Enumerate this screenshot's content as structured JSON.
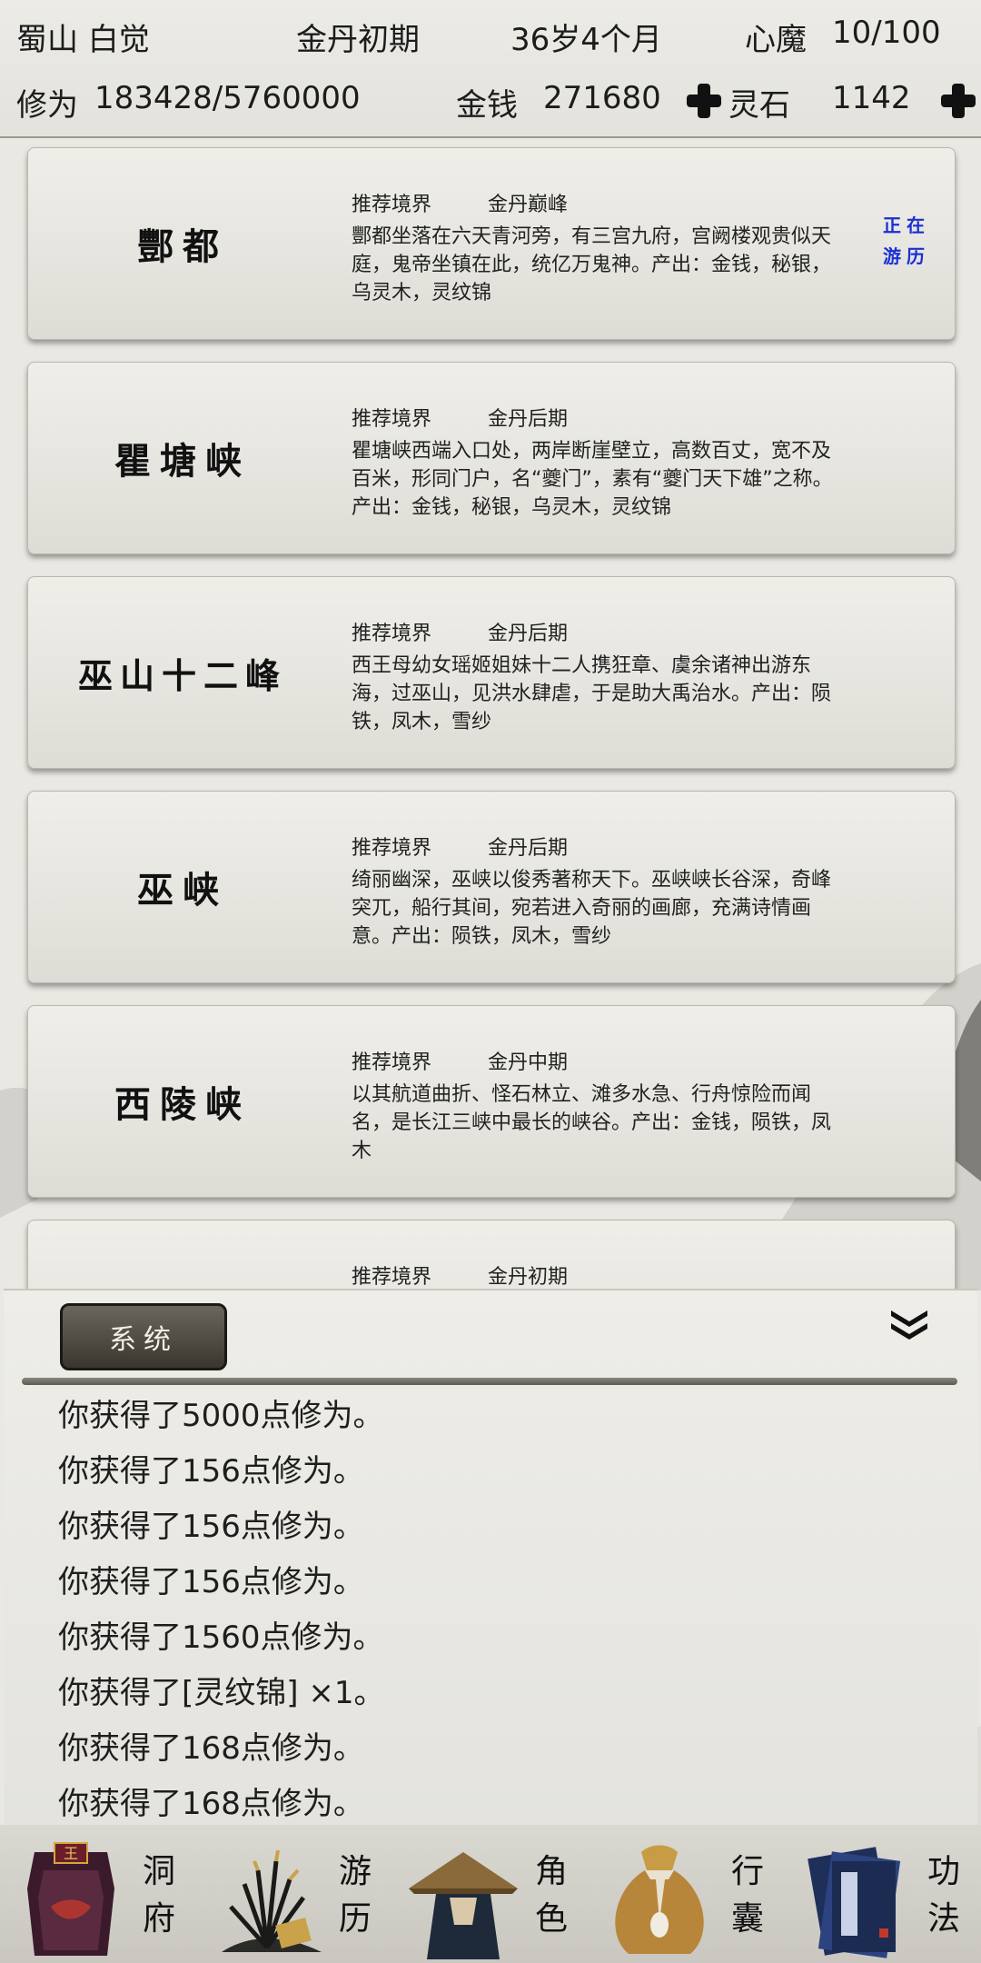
{
  "status": {
    "name": "蜀山 白觉",
    "realm": "金丹初期",
    "age": "36岁4个月",
    "heart_demon_label": "心魔",
    "heart_demon_value": "10/100",
    "cultivation_label": "修为",
    "cultivation_value": "183428/5760000",
    "money_label": "金钱",
    "money_value": "271680",
    "spirit_stone_label": "灵石",
    "spirit_stone_value": "1142"
  },
  "cards": [
    {
      "name": "酆都",
      "rec_label": "推荐境界",
      "rec_value": "金丹巅峰",
      "desc": "酆都坐落在六天青河旁，有三宫九府，宫阙楼观贵似天庭，鬼帝坐镇在此，统亿万鬼神。产出：金钱，秘银，乌灵木，灵纹锦",
      "status": "正在游历"
    },
    {
      "name": "瞿塘峡",
      "rec_label": "推荐境界",
      "rec_value": "金丹后期",
      "desc": "瞿塘峡西端入口处，两岸断崖壁立，高数百丈，宽不及百米，形同门户，名“夔门”，素有“夔门天下雄”之称。产出：金钱，秘银，乌灵木，灵纹锦"
    },
    {
      "name": "巫山十二峰",
      "rec_label": "推荐境界",
      "rec_value": "金丹后期",
      "desc": "西王母幼女瑶姬姐妹十二人携狂章、虞余诸神出游东海，过巫山，见洪水肆虐，于是助大禹治水。产出：陨铁，凤木，雪纱"
    },
    {
      "name": "巫峡",
      "rec_label": "推荐境界",
      "rec_value": "金丹后期",
      "desc": "绮丽幽深，巫峡以俊秀著称天下。巫峡峡长谷深，奇峰突兀，船行其间，宛若进入奇丽的画廊，充满诗情画意。产出：陨铁，凤木，雪纱"
    },
    {
      "name": "西陵峡",
      "rec_label": "推荐境界",
      "rec_value": "金丹中期",
      "desc": "以其航道曲折、怪石林立、滩多水急、行舟惊险而闻名，是长江三峡中最长的峡谷。产出：金钱，陨铁，凤木"
    },
    {
      "name": "",
      "rec_label": "推荐境界",
      "rec_value": "金丹初期",
      "desc": ""
    }
  ],
  "system_panel": {
    "tab_label": "系统",
    "logs": [
      "你获得了5000点修为。",
      "你获得了156点修为。",
      "你获得了156点修为。",
      "你获得了156点修为。",
      "你获得了1560点修为。",
      "你获得了[灵纹锦] ×1。",
      "你获得了168点修为。",
      "你获得了168点修为。"
    ]
  },
  "nav": [
    {
      "label": "洞府",
      "icon": "cave-mansion-icon"
    },
    {
      "label": "游历",
      "icon": "travel-icon"
    },
    {
      "label": "角色",
      "icon": "character-icon"
    },
    {
      "label": "行囊",
      "icon": "bag-icon"
    },
    {
      "label": "功法",
      "icon": "skill-book-icon"
    }
  ]
}
